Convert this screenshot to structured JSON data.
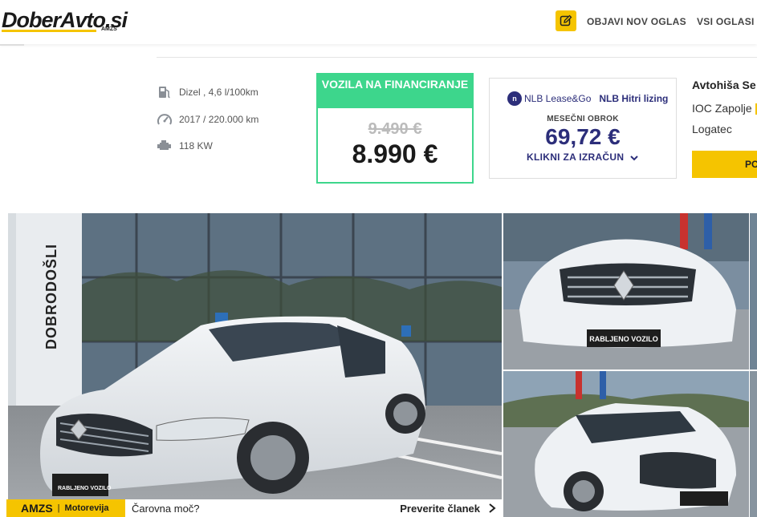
{
  "header": {
    "logo_main": "DoberAvto.si",
    "logo_sub": "AMZS",
    "nav": {
      "post_label": "OBJAVI NOV OGLAS",
      "all_label": "VSI OGLASI"
    }
  },
  "specs": [
    {
      "icon": "fuel-pump-icon",
      "text": "Dizel , 4,6 l/100km"
    },
    {
      "icon": "speedometer-icon",
      "text": "2017 / 220.000 km"
    },
    {
      "icon": "engine-icon",
      "text": "118 KW"
    }
  ],
  "financing": {
    "title": "VOZILA NA FINANCIRANJE",
    "old_price": "9.490 €",
    "price": "8.990 €"
  },
  "leasing": {
    "brand": "NLB Lease&Go",
    "product": "NLB Hitri lizing",
    "monthly_label": "MESEČNI OBROK",
    "monthly_amount": "69,72 €",
    "cta": "KLIKNI ZA IZRAČUN"
  },
  "dealer": {
    "name": "Avtohiša Se",
    "address": "IOC Zapolje",
    "city": "Logatec",
    "button": "PO"
  },
  "gallery": {
    "main_sign": "DOBRODOŠLI",
    "plate_text": "RABLJENO VOZILO"
  },
  "ad": {
    "brand": "AMZS",
    "section": "Motorevija",
    "headline": "Čarovna moč?",
    "cta": "Preverite članek"
  },
  "colors": {
    "accent_yellow": "#f5c400",
    "finance_green": "#3dd68c",
    "nlb_blue": "#2c2e7a"
  }
}
